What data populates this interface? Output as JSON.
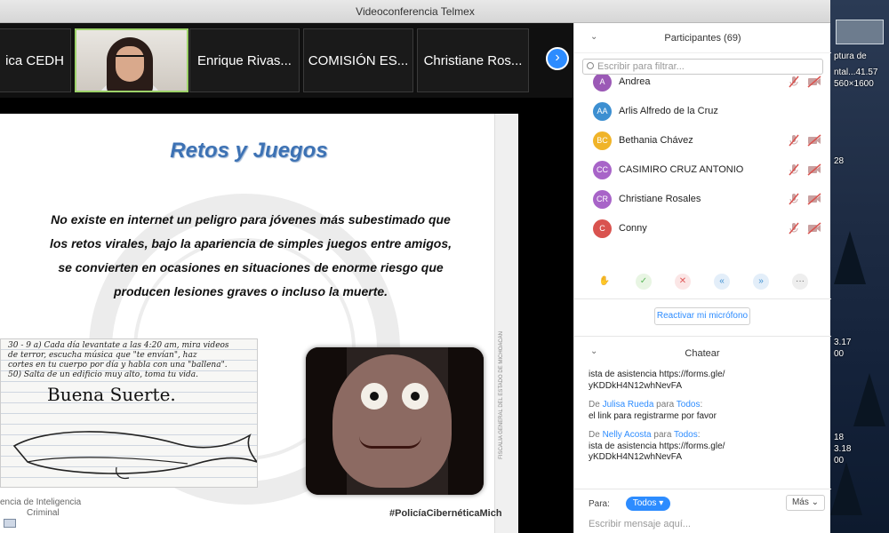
{
  "window": {
    "title": "Videoconferencia Telmex"
  },
  "video_strip": {
    "tiles": [
      {
        "label": "ica CEDH"
      },
      {
        "label": ""
      },
      {
        "label": "Enrique Rivas..."
      },
      {
        "label": "COMISIÓN ES..."
      },
      {
        "label": "Christiane Ros..."
      }
    ],
    "next_icon": "chevron-right-icon"
  },
  "slide": {
    "title": "Retos y Juegos",
    "body": "No existe en internet un peligro para jóvenes más subestimado que los retos virales,  bajo la apariencia de simples juegos entre amigos, se convierten en ocasiones en  situaciones de enorme riesgo que producen lesiones graves o incluso la muerte.",
    "handwriting_lines": [
      "30 - 9 a) Cada día levantate a las 4:20 am, mira videos",
      "de terror, escucha música que \"te envían\", haz",
      "cortes en tu cuerpo por día y habla con una \"ballena\".",
      "50) Salta de un edificio muy alto, toma tu vida."
    ],
    "handwriting_caption": "Buena Suerte.",
    "sidebar_text": "FISCALÍA GENERAL DEL ESTADO DE MICHOACÁN",
    "footer_left_1": "encia de Inteligencia",
    "footer_left_2": "Criminal",
    "footer_right": "#PolicíaCibernéticaMich"
  },
  "participants": {
    "header": "Participantes (69)",
    "filter_placeholder": "Escribir para filtrar...",
    "items": [
      {
        "initials": "A",
        "name": "Andrea",
        "color": "#9b59b6"
      },
      {
        "initials": "AA",
        "name": "Arlis Alfredo de la Cruz",
        "color": "#3d8fd1"
      },
      {
        "initials": "BC",
        "name": "Bethania Chávez",
        "color": "#f0b429"
      },
      {
        "initials": "CC",
        "name": "CASIMIRO CRUZ ANTONIO",
        "color": "#a864c8"
      },
      {
        "initials": "CR",
        "name": "Christiane Rosales",
        "color": "#a864c8"
      },
      {
        "initials": "C",
        "name": "Conny",
        "color": "#d9534f"
      }
    ],
    "reactions": [
      {
        "icon": "raise-hand-icon",
        "glyph": "✋",
        "color": "#f0b060"
      },
      {
        "icon": "yes-icon",
        "glyph": "✓",
        "color": "#5cb85c"
      },
      {
        "icon": "no-icon",
        "glyph": "✕",
        "color": "#e05a5a"
      },
      {
        "icon": "go-slower-icon",
        "glyph": "«",
        "color": "#3d8fd1"
      },
      {
        "icon": "go-faster-icon",
        "glyph": "»",
        "color": "#3d8fd1"
      },
      {
        "icon": "more-icon",
        "glyph": "···",
        "color": "#666"
      }
    ],
    "unmute_label": "Reactivar mi micrófono"
  },
  "chat": {
    "header": "Chatear",
    "messages": [
      {
        "from": "",
        "to": "",
        "text": "ista de asistencia https://forms.gle/\nyKDDkH4N12whNevFA"
      },
      {
        "from": "Julisa Rueda",
        "to": "Todos",
        "text": "el link para registrarme por favor"
      },
      {
        "from": "Nelly Acosta",
        "to": "Todos",
        "text": "ista de asistencia https://forms.gle/\nyKDDkH4N12whNevFA"
      }
    ],
    "de_label": "De",
    "para_label": "para",
    "to_label": "Para:",
    "to_value": "Todos",
    "more_label": "Más",
    "input_placeholder": "Escribir mensaje aquí..."
  },
  "desktop": {
    "labels": [
      "ptura de",
      "ntal...41.57",
      "560×1600",
      "28",
      "3.17",
      "00",
      "18",
      "3.18",
      "00"
    ]
  }
}
